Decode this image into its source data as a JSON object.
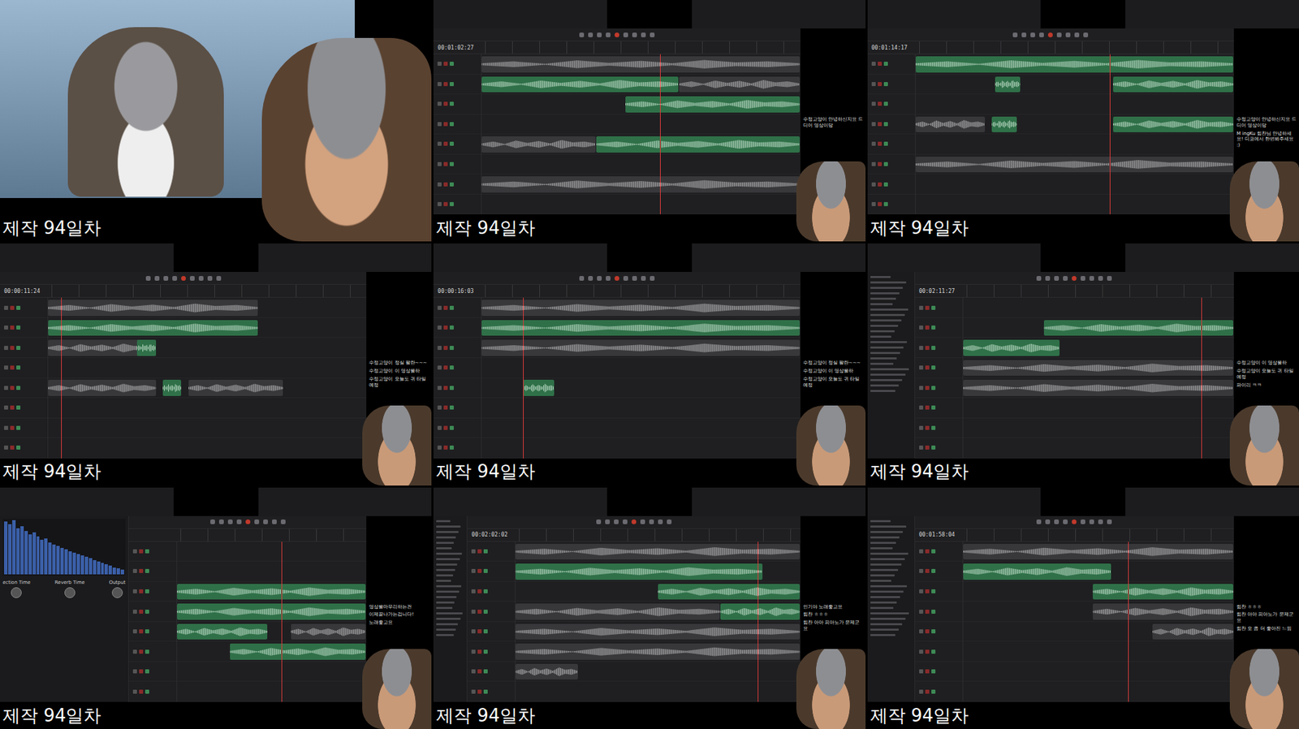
{
  "cells": [
    {
      "kind": "photo",
      "caption": "제작 94일차"
    },
    {
      "kind": "timeline",
      "caption": "제작 94일차",
      "timecode": "00:01:02:27",
      "playhead": 0.56,
      "clips": [
        {
          "selected": false
        },
        {
          "selected": true
        },
        {
          "selected": false
        },
        {
          "selected": true
        },
        {
          "selected": false
        },
        {
          "selected": true
        },
        {
          "selected": false
        }
      ],
      "chat": [
        "수정고양이 안녕하신지요 드디어 영상이당"
      ]
    },
    {
      "kind": "timeline",
      "caption": "제작 94일차",
      "timecode": "00:01:14:17",
      "playhead": 0.61,
      "clips": [
        {
          "selected": true
        },
        {
          "selected": true
        },
        {
          "selected": true
        },
        {
          "selected": false
        },
        {
          "selected": true
        },
        {
          "selected": true
        },
        {
          "selected": false
        }
      ],
      "chat": [
        "수정고양이 안녕하신지요 드디어 영상이당",
        "M ingKu 힘찬님 안녕하세요! 디코에서 한번봐주세요 :)"
      ]
    },
    {
      "kind": "timeline",
      "caption": "제작 94일차",
      "timecode": "00:00:11:24",
      "playhead": 0.04,
      "clips": [
        {
          "selected": false
        },
        {
          "selected": true
        },
        {
          "selected": false
        },
        {
          "selected": true
        },
        {
          "selected": false
        },
        {
          "selected": true
        },
        {
          "selected": false
        }
      ],
      "chat": [
        "수정고양이 정실 팔란~~~",
        "수정고양이 이 영상을하",
        "수정고양이 오늘도 귀 타일 예정"
      ]
    },
    {
      "kind": "timeline",
      "caption": "제작 94일차",
      "timecode": "00:00:16:03",
      "playhead": 0.13,
      "clips": [
        {
          "selected": false
        },
        {
          "selected": true
        },
        {
          "selected": false
        },
        {
          "selected": true
        }
      ],
      "chat": [
        "수정고양이 정실 팔란~~~",
        "수정고양이 이 영상을하",
        "수정고양이 오늘도 귀 타일 예정"
      ]
    },
    {
      "kind": "timeline",
      "caption": "제작 94일차",
      "timecode": "00:02:11:27",
      "playhead": 0.88,
      "clips": [
        {
          "selected": true
        },
        {
          "selected": true
        },
        {
          "selected": false
        },
        {
          "selected": false
        }
      ],
      "chat": [
        "수정고양이 이 영상을하",
        "수정고양이 오늘도 귀 타일 예정",
        "파이리 ㅋㅋ"
      ]
    },
    {
      "kind": "plugin",
      "caption": "제작 94일차",
      "playhead": 0.55,
      "clips": [
        {
          "selected": true
        },
        {
          "selected": true
        },
        {
          "selected": true
        },
        {
          "selected": false
        },
        {
          "selected": true
        }
      ],
      "spectrum": [
        92,
        88,
        95,
        80,
        84,
        76,
        70,
        73,
        66,
        60,
        63,
        55,
        52,
        50,
        46,
        44,
        40,
        38,
        35,
        33,
        30,
        28,
        25,
        22,
        20,
        18,
        15,
        12,
        10,
        8
      ],
      "knob_labels": [
        "ection Time",
        "Reverb Time",
        "Output"
      ],
      "chat": [
        "영상을마무리하는건",
        "이제끝나가는겁니다!",
        "노래좋고요"
      ]
    },
    {
      "kind": "timeline",
      "caption": "제작 94일차",
      "timecode": "00:02:02:02",
      "playhead": 0.85,
      "clips": [
        {
          "selected": false
        },
        {
          "selected": true
        },
        {
          "selected": true
        },
        {
          "selected": false
        },
        {
          "selected": true
        },
        {
          "selected": false
        },
        {
          "selected": false
        },
        {
          "selected": false
        }
      ],
      "chat": [
        "인기야 노래좋고요",
        "힘찬 ㅎㅎㅎ",
        "힘찬 아아 피아노가 문제군요"
      ]
    },
    {
      "kind": "timeline",
      "caption": "제작 94일차",
      "timecode": "00:01:58:04",
      "playhead": 0.61,
      "clips": [
        {
          "selected": false
        },
        {
          "selected": true
        },
        {
          "selected": true
        },
        {
          "selected": false
        },
        {
          "selected": false
        }
      ],
      "chat": [
        "힘찬 ㅎㅎㅎ",
        "힘찬 아아 피아노가 문제군요",
        "힘찬 오 좀 더 좋아진 느낌"
      ]
    }
  ]
}
